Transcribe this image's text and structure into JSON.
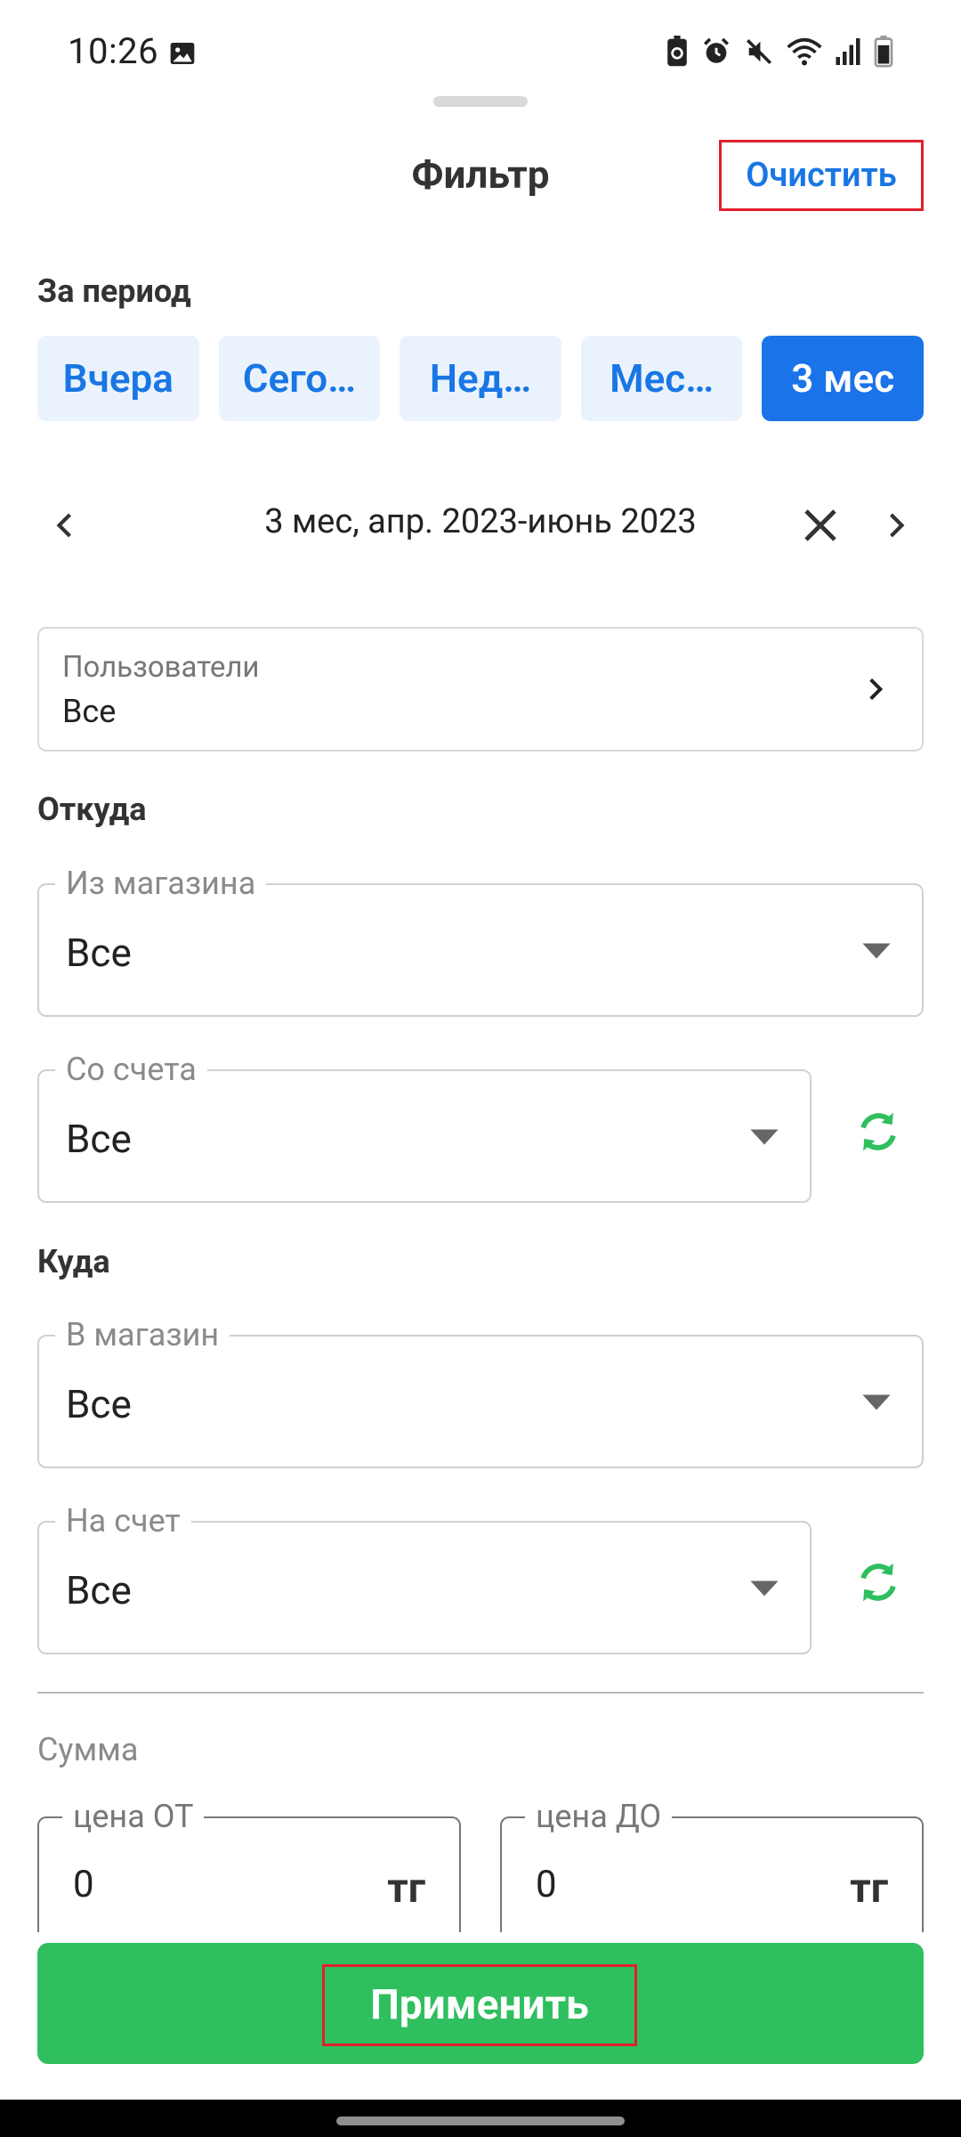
{
  "status_bar": {
    "time": "10:26",
    "left_icons": [
      "image-icon"
    ],
    "right_icons": [
      "battery-saver-icon",
      "alarm-icon",
      "mute-icon",
      "wifi-icon",
      "signal-icon",
      "battery-icon"
    ]
  },
  "header": {
    "title": "Фильтр",
    "clear_label": "Очистить"
  },
  "period": {
    "label": "За период",
    "options": [
      "Вчера",
      "Сего…",
      "Нед…",
      "Мес…",
      "3 мес"
    ],
    "selected": "3 мес"
  },
  "date_range": {
    "text": "3 мес, апр. 2023-июнь 2023"
  },
  "users": {
    "caption": "Пользователи",
    "value": "Все"
  },
  "from": {
    "label": "Откуда",
    "store": {
      "legend": "Из магазина",
      "value": "Все"
    },
    "account": {
      "legend": "Со счета",
      "value": "Все"
    }
  },
  "to": {
    "label": "Куда",
    "store": {
      "legend": "В магазин",
      "value": "Все"
    },
    "account": {
      "legend": "На счет",
      "value": "Все"
    }
  },
  "sum": {
    "label": "Сумма",
    "from": {
      "legend": "цена ОТ",
      "value": "0",
      "currency": "тг"
    },
    "to": {
      "legend": "цена ДО",
      "value": "0",
      "currency": "тг"
    }
  },
  "apply_label": "Применить",
  "colors": {
    "accent": "#1976e4",
    "accent_active": "#1a73e8",
    "chip_bg": "#eaf3fd",
    "apply_green": "#2fbf5f",
    "sync_green": "#2fbf5f",
    "highlight_red": "#e0202a"
  }
}
